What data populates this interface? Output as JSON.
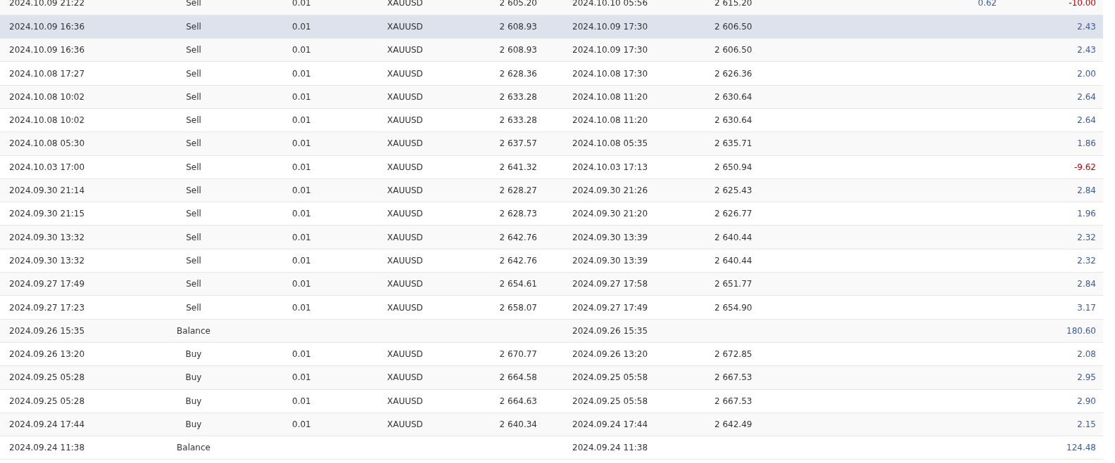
{
  "rows": [
    {
      "open_time": "2024.10.09 21:22",
      "type": "Sell",
      "volume": "0.01",
      "symbol": "XAUUSD",
      "open_price": "2 605.20",
      "close_time": "2024.10.10 05:56",
      "close_price": "2 615.20",
      "column_8": "0.62",
      "profit": "-10.00",
      "loss": true,
      "selected": false
    },
    {
      "open_time": "2024.10.09 16:36",
      "type": "Sell",
      "volume": "0.01",
      "symbol": "XAUUSD",
      "open_price": "2 608.93",
      "close_time": "2024.10.09 17:30",
      "close_price": "2 606.50",
      "profit": "2.43",
      "loss": false,
      "selected": true
    },
    {
      "open_time": "2024.10.09 16:36",
      "type": "Sell",
      "volume": "0.01",
      "symbol": "XAUUSD",
      "open_price": "2 608.93",
      "close_time": "2024.10.09 17:30",
      "close_price": "2 606.50",
      "profit": "2.43",
      "loss": false,
      "selected": false
    },
    {
      "open_time": "2024.10.08 17:27",
      "type": "Sell",
      "volume": "0.01",
      "symbol": "XAUUSD",
      "open_price": "2 628.36",
      "close_time": "2024.10.08 17:30",
      "close_price": "2 626.36",
      "profit": "2.00",
      "loss": false,
      "selected": false
    },
    {
      "open_time": "2024.10.08 10:02",
      "type": "Sell",
      "volume": "0.01",
      "symbol": "XAUUSD",
      "open_price": "2 633.28",
      "close_time": "2024.10.08 11:20",
      "close_price": "2 630.64",
      "profit": "2.64",
      "loss": false,
      "selected": false
    },
    {
      "open_time": "2024.10.08 10:02",
      "type": "Sell",
      "volume": "0.01",
      "symbol": "XAUUSD",
      "open_price": "2 633.28",
      "close_time": "2024.10.08 11:20",
      "close_price": "2 630.64",
      "profit": "2.64",
      "loss": false,
      "selected": false
    },
    {
      "open_time": "2024.10.08 05:30",
      "type": "Sell",
      "volume": "0.01",
      "symbol": "XAUUSD",
      "open_price": "2 637.57",
      "close_time": "2024.10.08 05:35",
      "close_price": "2 635.71",
      "profit": "1.86",
      "loss": false,
      "selected": false
    },
    {
      "open_time": "2024.10.03 17:00",
      "type": "Sell",
      "volume": "0.01",
      "symbol": "XAUUSD",
      "open_price": "2 641.32",
      "close_time": "2024.10.03 17:13",
      "close_price": "2 650.94",
      "profit": "-9.62",
      "loss": true,
      "selected": false
    },
    {
      "open_time": "2024.09.30 21:14",
      "type": "Sell",
      "volume": "0.01",
      "symbol": "XAUUSD",
      "open_price": "2 628.27",
      "close_time": "2024.09.30 21:26",
      "close_price": "2 625.43",
      "profit": "2.84",
      "loss": false,
      "selected": false
    },
    {
      "open_time": "2024.09.30 21:15",
      "type": "Sell",
      "volume": "0.01",
      "symbol": "XAUUSD",
      "open_price": "2 628.73",
      "close_time": "2024.09.30 21:20",
      "close_price": "2 626.77",
      "profit": "1.96",
      "loss": false,
      "selected": false
    },
    {
      "open_time": "2024.09.30 13:32",
      "type": "Sell",
      "volume": "0.01",
      "symbol": "XAUUSD",
      "open_price": "2 642.76",
      "close_time": "2024.09.30 13:39",
      "close_price": "2 640.44",
      "profit": "2.32",
      "loss": false,
      "selected": false
    },
    {
      "open_time": "2024.09.30 13:32",
      "type": "Sell",
      "volume": "0.01",
      "symbol": "XAUUSD",
      "open_price": "2 642.76",
      "close_time": "2024.09.30 13:39",
      "close_price": "2 640.44",
      "profit": "2.32",
      "loss": false,
      "selected": false
    },
    {
      "open_time": "2024.09.27 17:49",
      "type": "Sell",
      "volume": "0.01",
      "symbol": "XAUUSD",
      "open_price": "2 654.61",
      "close_time": "2024.09.27 17:58",
      "close_price": "2 651.77",
      "profit": "2.84",
      "loss": false,
      "selected": false
    },
    {
      "open_time": "2024.09.27 17:23",
      "type": "Sell",
      "volume": "0.01",
      "symbol": "XAUUSD",
      "open_price": "2 658.07",
      "close_time": "2024.09.27 17:49",
      "close_price": "2 654.90",
      "profit": "3.17",
      "loss": false,
      "selected": false
    },
    {
      "open_time": "2024.09.26 15:35",
      "type": "Balance",
      "close_time": "2024.09.26 15:35",
      "profit": "180.60",
      "loss": false,
      "selected": false
    },
    {
      "open_time": "2024.09.26 13:20",
      "type": "Buy",
      "volume": "0.01",
      "symbol": "XAUUSD",
      "open_price": "2 670.77",
      "close_time": "2024.09.26 13:20",
      "close_price": "2 672.85",
      "profit": "2.08",
      "loss": false,
      "selected": false
    },
    {
      "open_time": "2024.09.25 05:28",
      "type": "Buy",
      "volume": "0.01",
      "symbol": "XAUUSD",
      "open_price": "2 664.58",
      "close_time": "2024.09.25 05:58",
      "close_price": "2 667.53",
      "profit": "2.95",
      "loss": false,
      "selected": false
    },
    {
      "open_time": "2024.09.25 05:28",
      "type": "Buy",
      "volume": "0.01",
      "symbol": "XAUUSD",
      "open_price": "2 664.63",
      "close_time": "2024.09.25 05:58",
      "close_price": "2 667.53",
      "profit": "2.90",
      "loss": false,
      "selected": false
    },
    {
      "open_time": "2024.09.24 17:44",
      "type": "Buy",
      "volume": "0.01",
      "symbol": "XAUUSD",
      "open_price": "2 640.34",
      "close_time": "2024.09.24 17:44",
      "close_price": "2 642.49",
      "profit": "2.15",
      "loss": false,
      "selected": false
    },
    {
      "open_time": "2024.09.24 11:38",
      "type": "Balance",
      "close_time": "2024.09.24 11:38",
      "profit": "124.48",
      "loss": false,
      "selected": false
    }
  ]
}
